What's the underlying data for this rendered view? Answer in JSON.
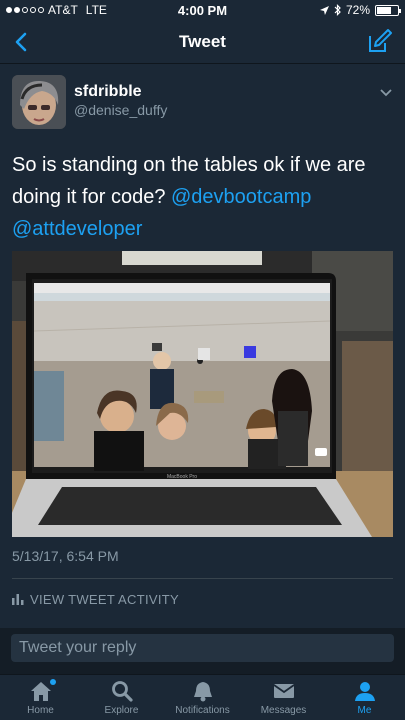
{
  "status_bar": {
    "carrier": "AT&T",
    "network": "LTE",
    "time": "4:00 PM",
    "battery": "72%",
    "battery_level": 0.72
  },
  "nav": {
    "title": "Tweet",
    "back_icon": "chevron-left-icon",
    "compose_icon": "compose-icon"
  },
  "tweet": {
    "display_name": "sfdribble",
    "handle": "@denise_duffy",
    "text_prefix": "So is standing on the tables ok if we are doing it for code? ",
    "mention_1": "@devbootcamp",
    "mention_2": "@attdeveloper",
    "timestamp": "5/13/17, 6:54 PM",
    "activity_label": "VIEW TWEET ACTIVITY",
    "laptop_brand": "MacBook Pro"
  },
  "reply": {
    "placeholder": "Tweet your reply"
  },
  "tabs": [
    {
      "label": "Home",
      "icon": "home-icon"
    },
    {
      "label": "Explore",
      "icon": "search-icon"
    },
    {
      "label": "Notifications",
      "icon": "bell-icon"
    },
    {
      "label": "Messages",
      "icon": "envelope-icon"
    },
    {
      "label": "Me",
      "icon": "person-icon"
    }
  ],
  "colors": {
    "accent": "#1da1f2",
    "background": "#1b2836",
    "secondary_text": "#8899a6"
  }
}
